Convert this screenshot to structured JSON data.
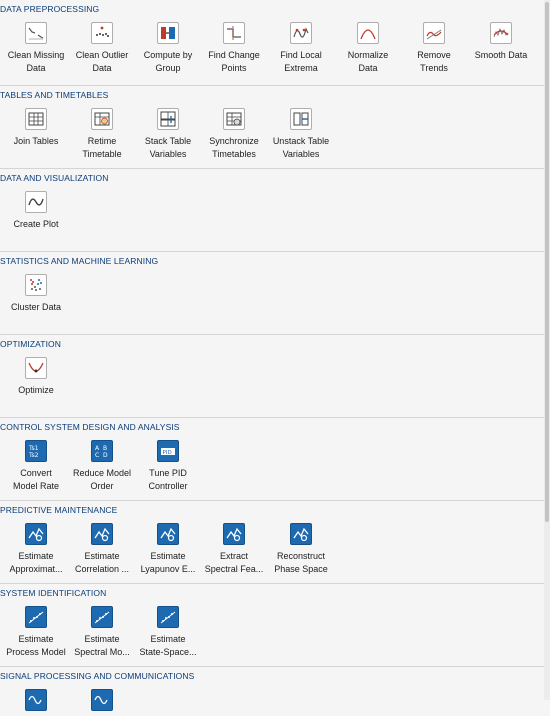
{
  "sections": [
    {
      "title": "DATA PREPROCESSING",
      "tools": [
        {
          "line1": "Clean Missing",
          "line2": "Data",
          "icon": "missing-data-icon"
        },
        {
          "line1": "Clean Outlier",
          "line2": "Data",
          "icon": "outlier-data-icon"
        },
        {
          "line1": "Compute by",
          "line2": "Group",
          "icon": "compute-group-icon"
        },
        {
          "line1": "Find Change",
          "line2": "Points",
          "icon": "change-points-icon"
        },
        {
          "line1": "Find Local",
          "line2": "Extrema",
          "icon": "local-extrema-icon"
        },
        {
          "line1": "Normalize",
          "line2": "Data",
          "icon": "normalize-icon"
        },
        {
          "line1": "Remove",
          "line2": "Trends",
          "icon": "remove-trends-icon"
        },
        {
          "line1": "Smooth Data",
          "line2": "",
          "icon": "smooth-data-icon"
        }
      ]
    },
    {
      "title": "TABLES AND TIMETABLES",
      "tools": [
        {
          "line1": "Join Tables",
          "line2": "",
          "icon": "join-tables-icon"
        },
        {
          "line1": "Retime",
          "line2": "Timetable",
          "icon": "retime-icon"
        },
        {
          "line1": "Stack Table",
          "line2": "Variables",
          "icon": "stack-table-icon"
        },
        {
          "line1": "Synchronize",
          "line2": "Timetables",
          "icon": "synchronize-icon"
        },
        {
          "line1": "Unstack Table",
          "line2": "Variables",
          "icon": "unstack-table-icon"
        }
      ]
    },
    {
      "title": "DATA AND VISUALIZATION",
      "tools": [
        {
          "line1": "Create Plot",
          "line2": "",
          "icon": "create-plot-icon"
        }
      ]
    },
    {
      "title": "STATISTICS AND MACHINE LEARNING",
      "tools": [
        {
          "line1": "Cluster Data",
          "line2": "",
          "icon": "cluster-data-icon"
        }
      ]
    },
    {
      "title": "OPTIMIZATION",
      "tools": [
        {
          "line1": "Optimize",
          "line2": "",
          "icon": "optimize-icon"
        }
      ]
    },
    {
      "title": "CONTROL SYSTEM DESIGN AND ANALYSIS",
      "tools": [
        {
          "line1": "Convert",
          "line2": "Model Rate",
          "icon": "convert-rate-icon"
        },
        {
          "line1": "Reduce Model",
          "line2": "Order",
          "icon": "reduce-order-icon"
        },
        {
          "line1": "Tune PID",
          "line2": "Controller",
          "icon": "pid-icon"
        }
      ]
    },
    {
      "title": "PREDICTIVE MAINTENANCE",
      "tools": [
        {
          "line1": "Estimate",
          "line2": "Approximat...",
          "icon": "wrench-chart-icon"
        },
        {
          "line1": "Estimate",
          "line2": "Correlation ...",
          "icon": "wrench-chart-icon"
        },
        {
          "line1": "Estimate",
          "line2": "Lyapunov E...",
          "icon": "wrench-chart-icon"
        },
        {
          "line1": "Extract",
          "line2": "Spectral Fea...",
          "icon": "wrench-chart-icon"
        },
        {
          "line1": "Reconstruct",
          "line2": "Phase Space",
          "icon": "wrench-chart-icon"
        }
      ]
    },
    {
      "title": "SYSTEM IDENTIFICATION",
      "tools": [
        {
          "line1": "Estimate",
          "line2": "Process Model",
          "icon": "sysid-icon"
        },
        {
          "line1": "Estimate",
          "line2": "Spectral Mo...",
          "icon": "sysid-icon"
        },
        {
          "line1": "Estimate",
          "line2": "State-Space...",
          "icon": "sysid-icon"
        }
      ]
    },
    {
      "title": "SIGNAL PROCESSING AND COMMUNICATIONS",
      "tools": [
        {
          "line1": "",
          "line2": "",
          "icon": "signal-icon"
        },
        {
          "line1": "",
          "line2": "",
          "icon": "signal-icon"
        }
      ]
    }
  ]
}
